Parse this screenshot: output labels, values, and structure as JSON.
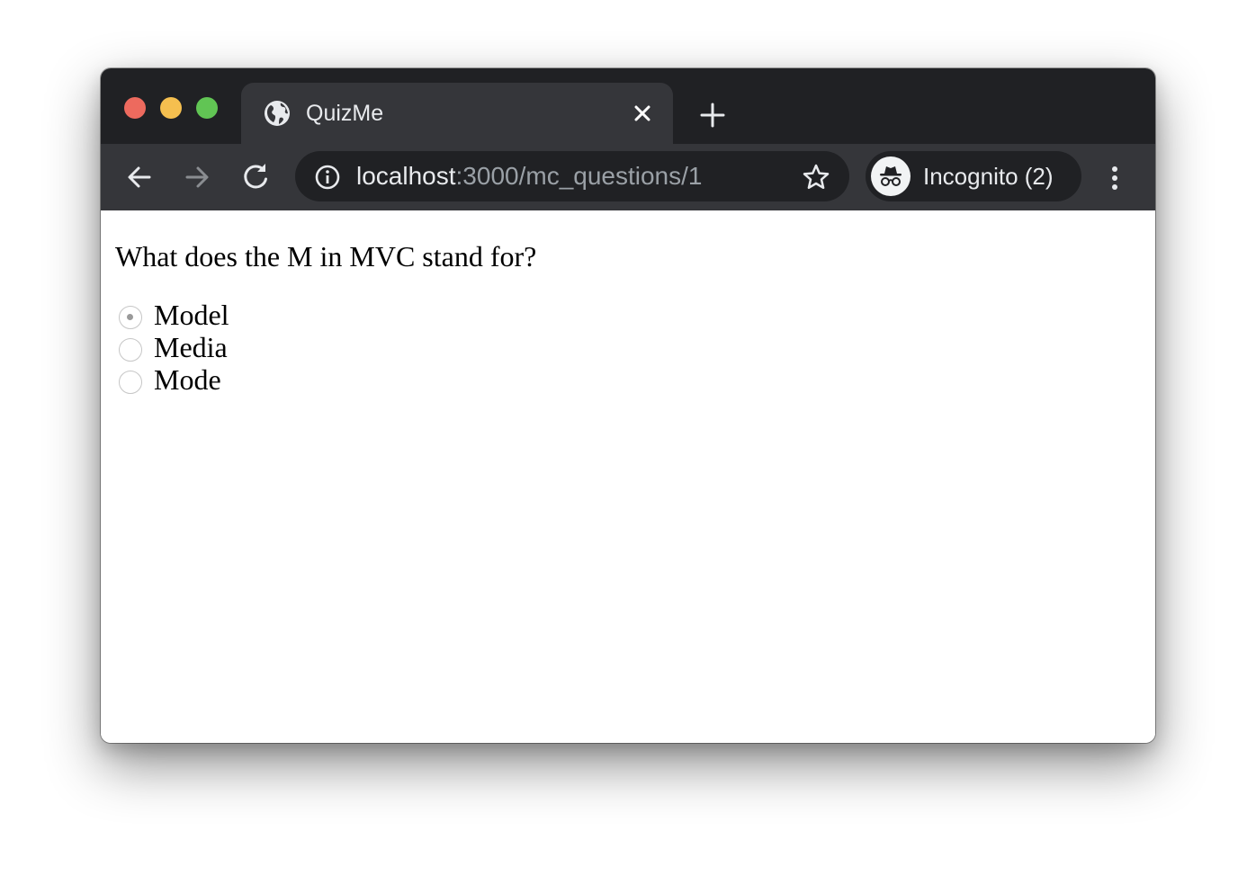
{
  "browser": {
    "tab": {
      "title": "QuizMe"
    },
    "address_bar": {
      "host": "localhost",
      "path": ":3000/mc_questions/1"
    },
    "profile": {
      "label": "Incognito (2)"
    }
  },
  "icons": {
    "favicon": "globe-icon",
    "close": "close-icon",
    "new_tab": "plus-icon",
    "back": "arrow-left-icon",
    "forward": "arrow-right-icon",
    "reload": "reload-icon",
    "site_info": "info-icon",
    "bookmark": "star-icon",
    "incognito": "incognito-icon",
    "menu": "more-vertical-icon"
  },
  "colors": {
    "titlebar": "#202124",
    "toolbar": "#35363a",
    "traffic_red": "#ed6a5e",
    "traffic_yellow": "#f5bf4f",
    "traffic_green": "#61c554"
  },
  "page": {
    "question": "What does the M in MVC stand for?",
    "answers": [
      {
        "label": "Model",
        "checked": true
      },
      {
        "label": "Media",
        "checked": false
      },
      {
        "label": "Mode",
        "checked": false
      }
    ]
  }
}
